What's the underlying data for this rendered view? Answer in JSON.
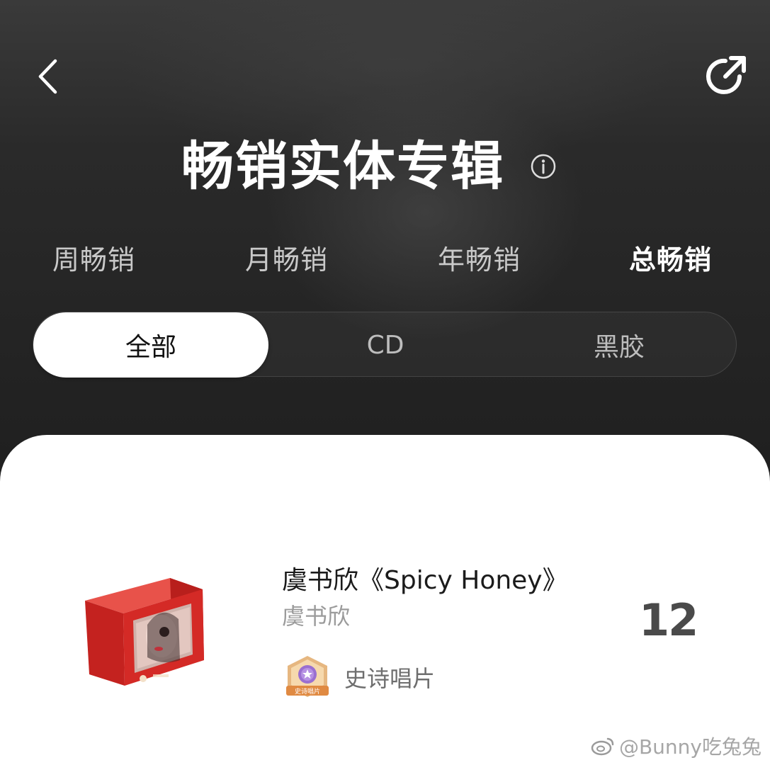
{
  "header": {
    "title": "畅销实体专辑",
    "back_icon": "chevron-left-icon",
    "share_icon": "share-arrow-icon",
    "info_icon": "info-circle-icon"
  },
  "period_tabs": [
    {
      "label": "周畅销",
      "active": false
    },
    {
      "label": "月畅销",
      "active": false
    },
    {
      "label": "年畅销",
      "active": false
    },
    {
      "label": "总畅销",
      "active": true
    }
  ],
  "format_filter": [
    {
      "label": "全部",
      "active": true
    },
    {
      "label": "CD",
      "active": false
    },
    {
      "label": "黑胶",
      "active": false
    }
  ],
  "album_item": {
    "title": "虞书欣《Spicy Honey》",
    "artist": "虞书欣",
    "rank": "12",
    "badge": {
      "label": "史诗唱片",
      "icon": "epic-record-badge-icon",
      "badge_text": "史诗唱片"
    }
  },
  "watermark": {
    "text": "@Bunny吃兔兔",
    "icon": "weibo-logo-icon"
  },
  "colors": {
    "background": "#262626",
    "sheet": "#ffffff",
    "active_tab": "#ffffff",
    "inactive_tab": "#c9c9c9",
    "cover_red": "#d42a26"
  }
}
